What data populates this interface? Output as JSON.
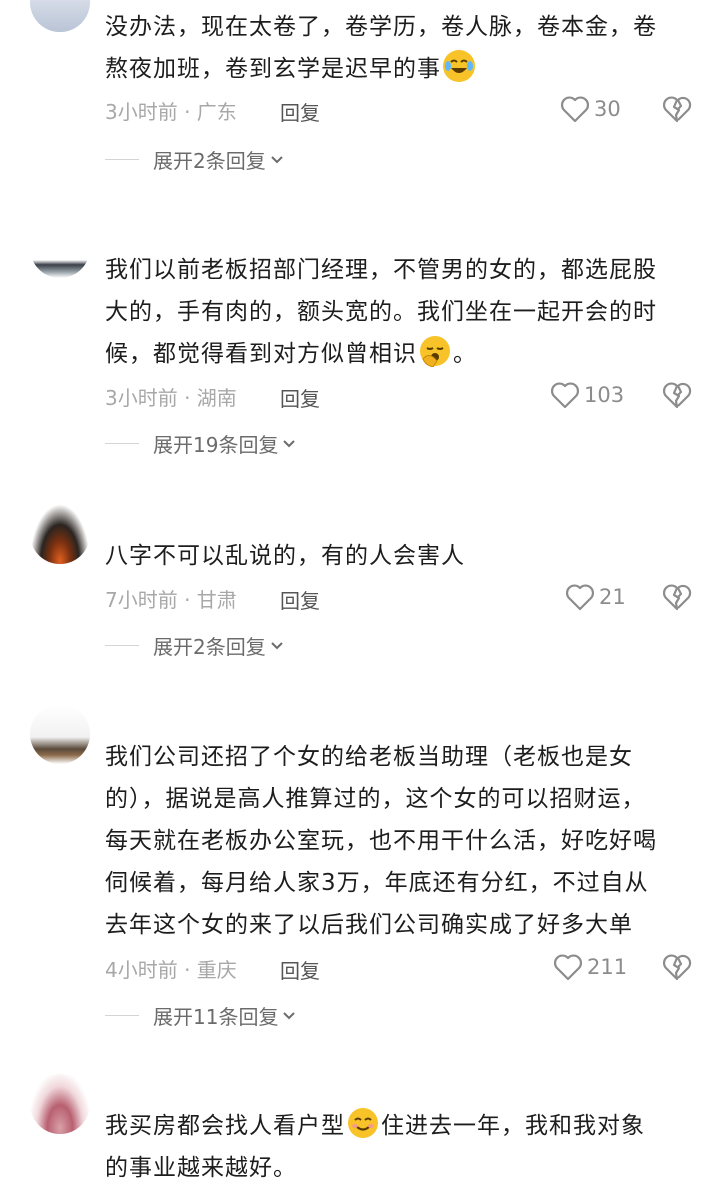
{
  "comments": [
    {
      "text_a": "没办法，现在太卷了，卷学历，卷人脉，卷本金，卷",
      "text_b": "熬夜加班，卷到玄学是迟早的事",
      "emoji": "rofl-emoji",
      "meta": "3小时前 · 广东",
      "reply": "回复",
      "likes": "30",
      "expand": "展开2条回复"
    },
    {
      "text_a": "我们以前老板招部门经理，不管男的女的，都选屁股",
      "text_b": "大的，手有肉的，额头宽的。我们坐在一起开会的时",
      "text_c": "候，都觉得看到对方似曾相识",
      "text_d": "。",
      "emoji": "yawn-emoji",
      "meta": "3小时前 · 湖南",
      "reply": "回复",
      "likes": "103",
      "expand": "展开19条回复"
    },
    {
      "text_a": "八字不可以乱说的，有的人会害人",
      "meta": "7小时前 · 甘肃",
      "reply": "回复",
      "likes": "21",
      "expand": "展开2条回复"
    },
    {
      "text_a": "我们公司还招了个女的给老板当助理（老板也是女",
      "text_b": "的），据说是高人推算过的，这个女的可以招财运，",
      "text_c": "每天就在老板办公室玩，也不用干什么活，好吃好喝",
      "text_d": "伺候着，每月给人家3万，年底还有分红，不过自从",
      "text_e": "去年这个女的来了以后我们公司确实成了好多大单",
      "meta": "4小时前 · 重庆",
      "reply": "回复",
      "likes": "211",
      "expand": "展开11条回复"
    },
    {
      "text_a": "我买房都会找人看户型",
      "text_b": "住进去一年，我和我对象",
      "text_c": "的事业越来越好。",
      "emoji": "smile-emoji"
    }
  ],
  "colors": {
    "text": "#1d1d1d",
    "meta": "#a8a8a8",
    "icon": "#8c8c8c",
    "emoji_yellow": "#f7c328"
  }
}
